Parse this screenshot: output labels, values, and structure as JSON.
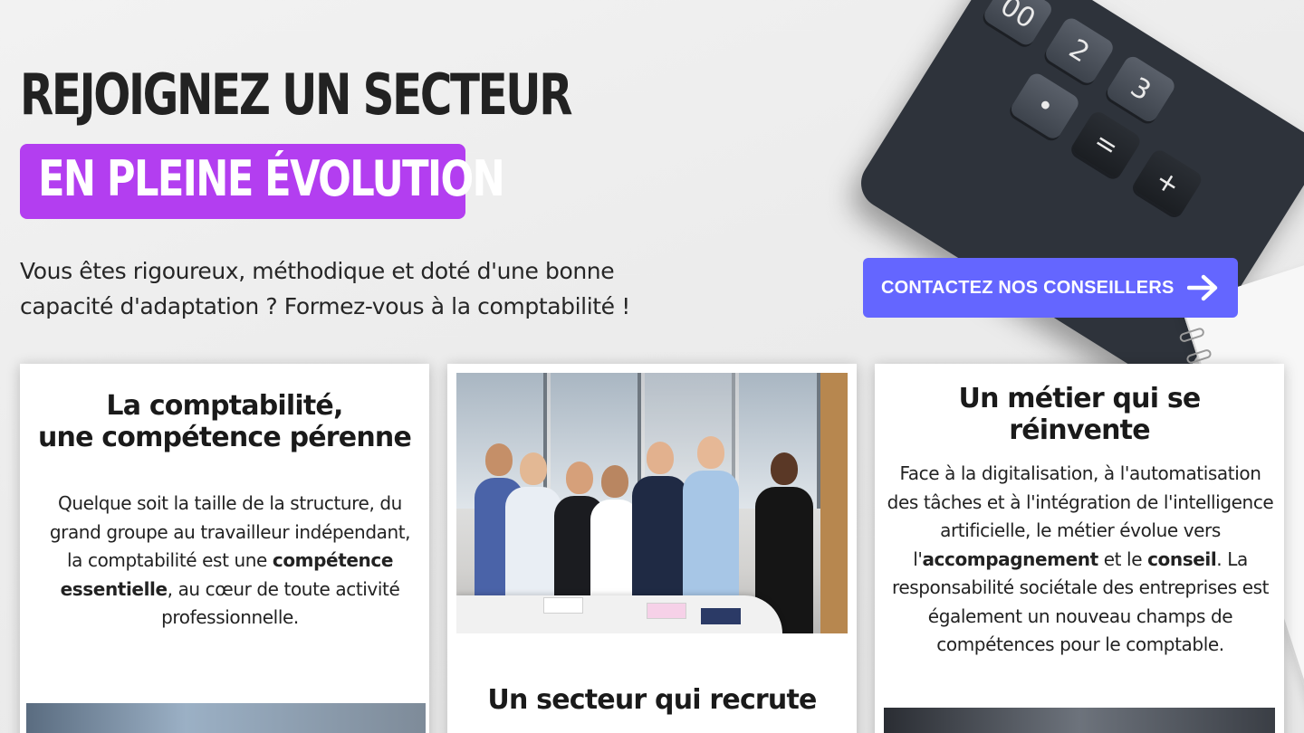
{
  "hero": {
    "headline": "REJOIGNEZ UN SECTEUR",
    "highlight": "EN PLEINE ÉVOLUTION",
    "intro_line1": "Vous êtes rigoureux, méthodique et doté d'une bonne",
    "intro_line2": "capacité d'adaptation ? Formez-vous à la comptabilité !",
    "cta_label": "CONTACTEZ NOS CONSEILLERS",
    "cta_icon": "arrow-right-icon"
  },
  "cards": {
    "left": {
      "title_line1": "La comptabilité,",
      "title_line2": "une compétence pérenne",
      "text_a": "Quelque soit la taille de la structure, du grand groupe au travailleur indépendant, la comptabilité est une ",
      "text_bold": "compétence essentielle",
      "text_b": ", au cœur de toute activité professionnelle."
    },
    "middle": {
      "title": "Un secteur qui recrute"
    },
    "right": {
      "title_line1": "Un métier qui se",
      "title_line2": "réinvente",
      "text_a": "Face à la digitalisation, à l'automatisation des tâches et à l'intégration de l'intelligence artificielle, le métier évolue vers l'",
      "text_bold1": "accompagnement",
      "text_b": " et le ",
      "text_bold2": "conseil",
      "text_c": ". La responsabilité sociétale des entreprises est également un nouveau champs de compétences pour le comptable."
    }
  },
  "decor": {
    "calculator_keys": [
      "00",
      "2",
      "3",
      "•",
      "=",
      "+"
    ],
    "accent_purple": "#b33ef0",
    "accent_blue": "#6466ff"
  }
}
